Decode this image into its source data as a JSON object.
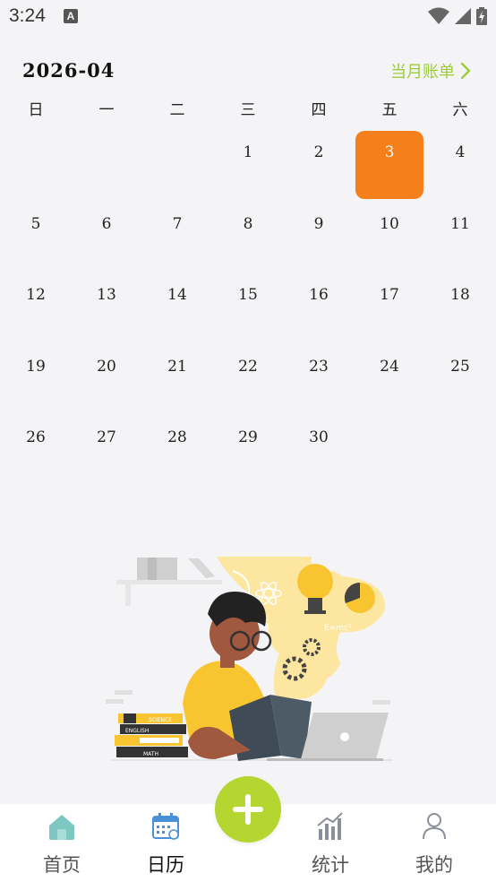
{
  "status": {
    "time": "3:24",
    "notif_letter": "A"
  },
  "calendar": {
    "month": "2026-04",
    "bill_link": "当月账单",
    "weekdays": [
      "日",
      "一",
      "二",
      "三",
      "四",
      "五",
      "六"
    ],
    "days": [
      "1",
      "2",
      "3",
      "4",
      "5",
      "6",
      "7",
      "8",
      "9",
      "10",
      "11",
      "12",
      "13",
      "14",
      "15",
      "16",
      "17",
      "18",
      "19",
      "20",
      "21",
      "22",
      "23",
      "24",
      "25",
      "26",
      "27",
      "28",
      "29",
      "30"
    ],
    "first_weekday_index": 3,
    "selected_day": "3",
    "selected_color": "#f47f1b"
  },
  "illustration": {
    "books": [
      "SCIENCE",
      "ENGLISH",
      "MATH"
    ],
    "formula": "E=mc²"
  },
  "tabbar": {
    "tabs": [
      {
        "label": "首页",
        "icon": "home-icon",
        "active": false
      },
      {
        "label": "日历",
        "icon": "calendar-icon",
        "active": true
      },
      {
        "label": "统计",
        "icon": "chart-icon",
        "active": false
      },
      {
        "label": "我的",
        "icon": "person-icon",
        "active": false
      }
    ],
    "fab_icon": "plus-icon",
    "fab_color": "#b5d631"
  },
  "colors": {
    "accent_green": "#9ccc3c",
    "background": "#f4f4f6"
  }
}
